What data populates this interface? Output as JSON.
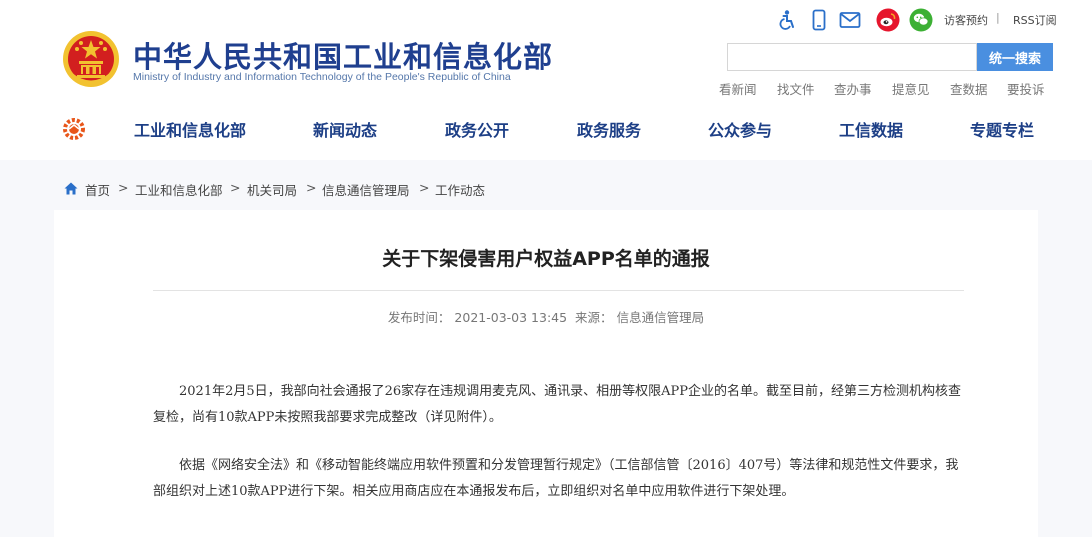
{
  "header": {
    "logo_cn": "中华人民共和国工业和信息化部",
    "logo_en": "Ministry of Industry and Information Technology of the People's Republic of China",
    "top_icons": [
      "accessibility-icon",
      "mobile-icon",
      "mail-icon",
      "weibo-icon",
      "wechat-icon"
    ],
    "visitor_link": "访客预约",
    "separator": "|",
    "rss_link": "RSS订阅",
    "search": {
      "placeholder": "",
      "button_label": "统一搜索"
    },
    "quick_links": [
      "看新闻",
      "找文件",
      "查办事",
      "提意见",
      "查数据",
      "要投诉"
    ]
  },
  "nav": {
    "items": [
      "工业和信息化部",
      "新闻动态",
      "政务公开",
      "政务服务",
      "公众参与",
      "工信数据",
      "专题专栏"
    ]
  },
  "breadcrumb": {
    "items": [
      "首页",
      "工业和信息化部",
      "机关司局",
      "信息通信管理局",
      "工作动态"
    ],
    "separator": ">"
  },
  "article": {
    "title": "关于下架侵害用户权益APP名单的通报",
    "publish_label": "发布时间：",
    "publish_time": "2021-03-03 13:45",
    "source_label": "来源：",
    "source": "信息通信管理局",
    "paragraphs": [
      "2021年2月5日，我部向社会通报了26家存在违规调用麦克风、通讯录、相册等权限APP企业的名单。截至目前，经第三方检测机构核查复检，尚有10款APP未按照我部要求完成整改（详见附件）。",
      "依据《网络安全法》和《移动智能终端应用软件预置和分发管理暂行规定》（工信部信管〔2016〕407号）等法律和规范性文件要求，我部组织对上述10款APP进行下架。相关应用商店应在本通报发布后，立即组织对名单中应用软件进行下架处理。"
    ]
  },
  "colors": {
    "brand_blue": "#1f3f8f",
    "nav_text": "#1d3f86",
    "search_button": "#4a8fe0",
    "weibo": "#e6162d",
    "wechat": "#3cb034",
    "emblem_red": "#d21f1f",
    "emblem_gold": "#f2c230"
  }
}
